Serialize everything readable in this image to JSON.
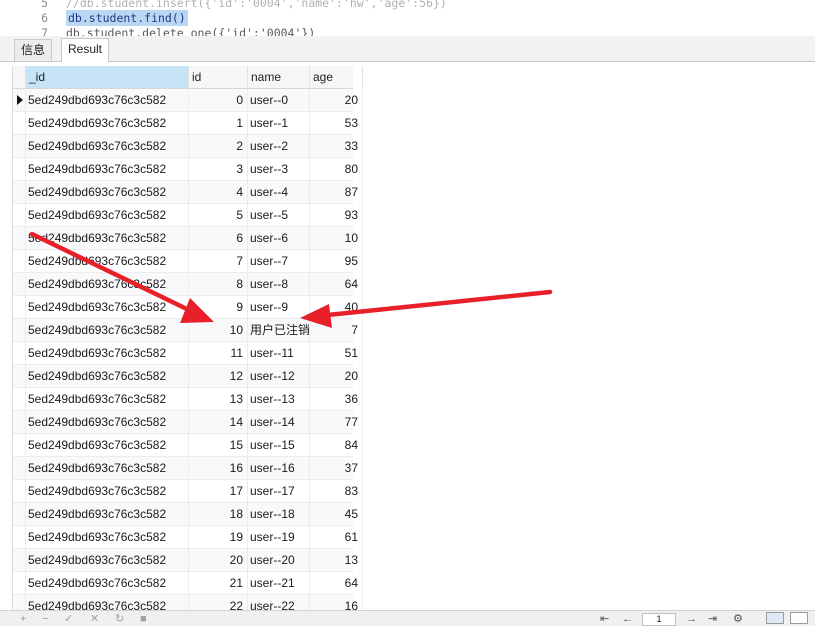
{
  "editor": {
    "lines": [
      {
        "num": "5",
        "text": "//db.student.insert({'id':'0004','name':'hw','age':56})",
        "kind": "comment"
      },
      {
        "num": "6",
        "text": "db.student.find()",
        "kind": "selected"
      },
      {
        "num": "7",
        "text": "db.student.delete_one({'id':'0004'})",
        "kind": "code"
      }
    ]
  },
  "tabs": [
    {
      "label": "信息",
      "active": false
    },
    {
      "label": "Result",
      "active": true
    }
  ],
  "grid": {
    "columns": [
      "_id",
      "id",
      "name",
      "age"
    ],
    "rows": [
      {
        "oid": "5ed249dbd693c76c3c582",
        "id": "0",
        "name": "user--0",
        "age": "20"
      },
      {
        "oid": "5ed249dbd693c76c3c582",
        "id": "1",
        "name": "user--1",
        "age": "53"
      },
      {
        "oid": "5ed249dbd693c76c3c582",
        "id": "2",
        "name": "user--2",
        "age": "33"
      },
      {
        "oid": "5ed249dbd693c76c3c582",
        "id": "3",
        "name": "user--3",
        "age": "80"
      },
      {
        "oid": "5ed249dbd693c76c3c582",
        "id": "4",
        "name": "user--4",
        "age": "87"
      },
      {
        "oid": "5ed249dbd693c76c3c582",
        "id": "5",
        "name": "user--5",
        "age": "93"
      },
      {
        "oid": "5ed249dbd693c76c3c582",
        "id": "6",
        "name": "user--6",
        "age": "10"
      },
      {
        "oid": "5ed249dbd693c76c3c582",
        "id": "7",
        "name": "user--7",
        "age": "95"
      },
      {
        "oid": "5ed249dbd693c76c3c582",
        "id": "8",
        "name": "user--8",
        "age": "64"
      },
      {
        "oid": "5ed249dbd693c76c3c582",
        "id": "9",
        "name": "user--9",
        "age": "40"
      },
      {
        "oid": "5ed249dbd693c76c3c582",
        "id": "10",
        "name": "用户已注销",
        "age": "7"
      },
      {
        "oid": "5ed249dbd693c76c3c582",
        "id": "11",
        "name": "user--11",
        "age": "51"
      },
      {
        "oid": "5ed249dbd693c76c3c582",
        "id": "12",
        "name": "user--12",
        "age": "20"
      },
      {
        "oid": "5ed249dbd693c76c3c582",
        "id": "13",
        "name": "user--13",
        "age": "36"
      },
      {
        "oid": "5ed249dbd693c76c3c582",
        "id": "14",
        "name": "user--14",
        "age": "77"
      },
      {
        "oid": "5ed249dbd693c76c3c582",
        "id": "15",
        "name": "user--15",
        "age": "84"
      },
      {
        "oid": "5ed249dbd693c76c3c582",
        "id": "16",
        "name": "user--16",
        "age": "37"
      },
      {
        "oid": "5ed249dbd693c76c3c582",
        "id": "17",
        "name": "user--17",
        "age": "83"
      },
      {
        "oid": "5ed249dbd693c76c3c582",
        "id": "18",
        "name": "user--18",
        "age": "45"
      },
      {
        "oid": "5ed249dbd693c76c3c582",
        "id": "19",
        "name": "user--19",
        "age": "61"
      },
      {
        "oid": "5ed249dbd693c76c3c582",
        "id": "20",
        "name": "user--20",
        "age": "13"
      },
      {
        "oid": "5ed249dbd693c76c3c582",
        "id": "21",
        "name": "user--21",
        "age": "64"
      },
      {
        "oid": "5ed249dbd693c76c3c582",
        "id": "22",
        "name": "user--22",
        "age": "16"
      }
    ]
  },
  "toolbar": {
    "page_value": "1",
    "icons": [
      "add-icon",
      "remove-icon",
      "apply-icon",
      "discard-icon",
      "refresh-icon",
      "stop-icon"
    ],
    "nav_icons": [
      "first-page-icon",
      "prev-page-icon",
      "next-page-icon",
      "last-page-icon",
      "settings-icon"
    ]
  },
  "colors": {
    "annotation_arrow": "#e8202a",
    "selection": "#b9d7f2",
    "header_selected": "#c7e3f6"
  }
}
